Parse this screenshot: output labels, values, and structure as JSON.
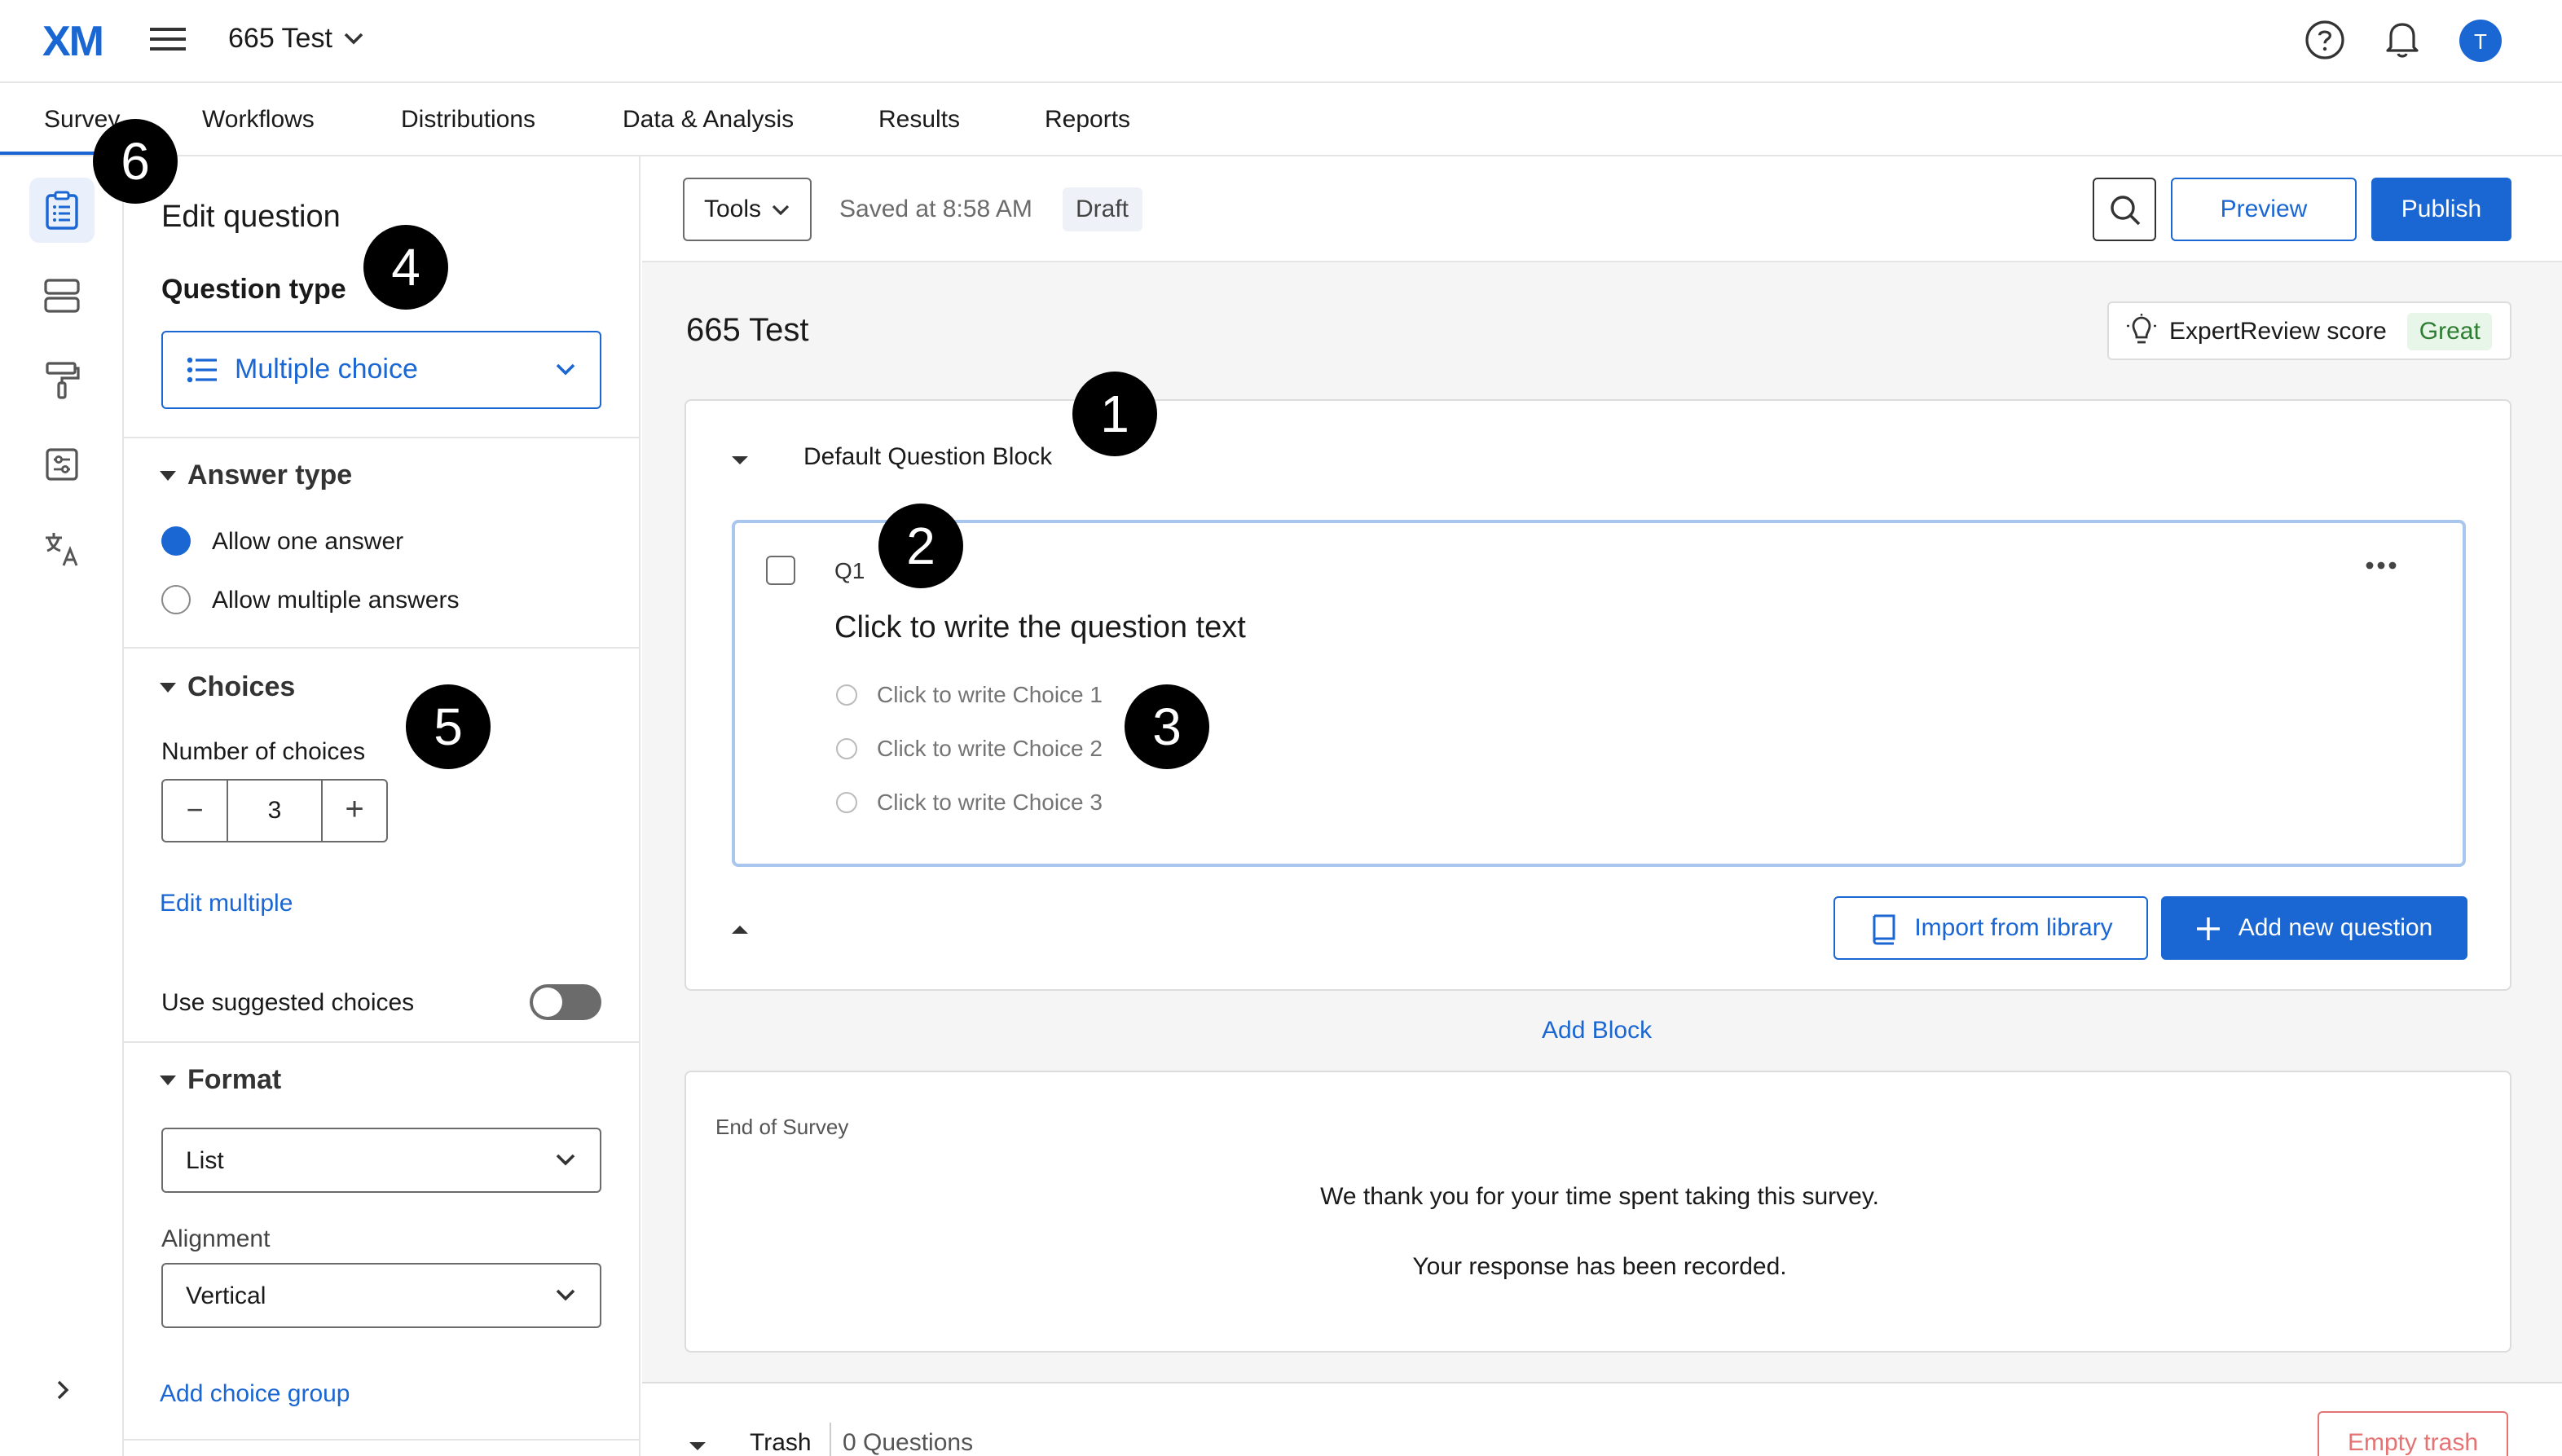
{
  "topbar": {
    "logo": "XM",
    "project_title": "665 Test",
    "avatar_initial": "T"
  },
  "tabs": [
    {
      "label": "Survey",
      "active": true
    },
    {
      "label": "Workflows"
    },
    {
      "label": "Distributions"
    },
    {
      "label": "Data & Analysis"
    },
    {
      "label": "Results"
    },
    {
      "label": "Reports"
    }
  ],
  "panel": {
    "title": "Edit question",
    "question_type_label": "Question type",
    "question_type_value": "Multiple choice",
    "answer_type": {
      "title": "Answer type",
      "options": [
        {
          "label": "Allow one answer",
          "selected": true
        },
        {
          "label": "Allow multiple answers",
          "selected": false
        }
      ]
    },
    "choices": {
      "title": "Choices",
      "number_label": "Number of choices",
      "number_value": "3",
      "minus": "−",
      "plus": "+",
      "edit_multiple": "Edit multiple",
      "suggested_label": "Use suggested choices",
      "suggested_on": false
    },
    "format": {
      "title": "Format",
      "format_value": "List",
      "alignment_label": "Alignment",
      "alignment_value": "Vertical",
      "add_choice_group": "Add choice group"
    }
  },
  "toolbar": {
    "tools": "Tools",
    "saved": "Saved at 8:58 AM",
    "status": "Draft",
    "preview": "Preview",
    "publish": "Publish"
  },
  "survey": {
    "title": "665 Test",
    "expert_review_label": "ExpertReview score",
    "expert_review_value": "Great",
    "block_title": "Default Question Block",
    "question": {
      "id": "Q1",
      "text": "Click to write the question text",
      "choices": [
        "Click to write Choice 1",
        "Click to write Choice 2",
        "Click to write Choice 3"
      ]
    },
    "import_library": "Import from library",
    "add_question": "Add new question",
    "add_block": "Add Block",
    "end_title": "End of Survey",
    "end_line1": "We thank you for your time spent taking this survey.",
    "end_line2": "Your response has been recorded.",
    "trash_label": "Trash",
    "trash_count": "0 Questions",
    "empty_trash": "Empty trash"
  },
  "markers": [
    "1",
    "2",
    "3",
    "4",
    "5",
    "6"
  ],
  "colors": {
    "accent": "#1a66d2",
    "great_green": "#2e7d32",
    "great_bg": "#e8f5e9",
    "empty_trash": "#e57373"
  }
}
